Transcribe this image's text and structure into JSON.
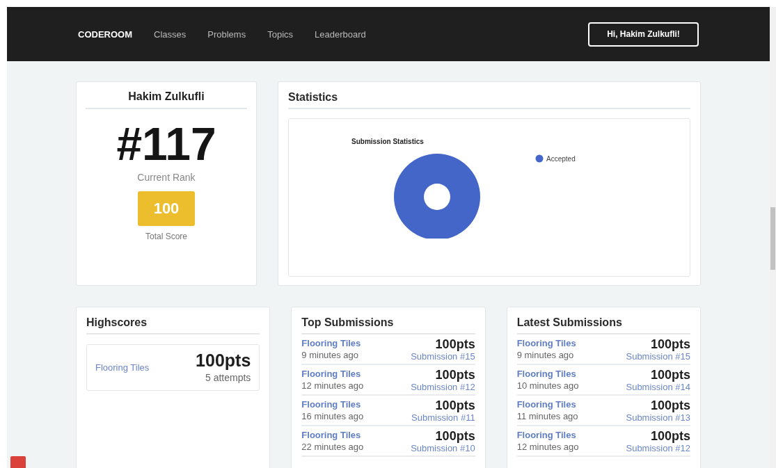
{
  "navbar": {
    "brand": "CODEROOM",
    "links": [
      {
        "label": "Classes"
      },
      {
        "label": "Problems"
      },
      {
        "label": "Topics"
      },
      {
        "label": "Leaderboard"
      }
    ],
    "user_button": "Hi, Hakim Zulkufli!"
  },
  "profile": {
    "name": "Hakim Zulkufli",
    "rank": "#117",
    "rank_label": "Current Rank",
    "score": "100",
    "score_label": "Total Score"
  },
  "statistics": {
    "title": "Statistics",
    "chart_data": {
      "type": "donut",
      "title": "Submission Statistics",
      "categories": [
        "Accepted"
      ]
    }
  },
  "highscores": {
    "title": "Highscores",
    "items": [
      {
        "problem": "Flooring Tiles",
        "points": "100pts",
        "attempts": "5 attempts"
      }
    ]
  },
  "top_submissions": {
    "title": "Top Submissions",
    "items": [
      {
        "problem": "Flooring Tiles",
        "time": "9 minutes ago",
        "points": "100pts",
        "submission": "Submission #15"
      },
      {
        "problem": "Flooring Tiles",
        "time": "12 minutes ago",
        "points": "100pts",
        "submission": "Submission #12"
      },
      {
        "problem": "Flooring Tiles",
        "time": "16 minutes ago",
        "points": "100pts",
        "submission": "Submission #11"
      },
      {
        "problem": "Flooring Tiles",
        "time": "22 minutes ago",
        "points": "100pts",
        "submission": "Submission #10"
      }
    ]
  },
  "latest_submissions": {
    "title": "Latest Submissions",
    "items": [
      {
        "problem": "Flooring Tiles",
        "time": "9 minutes ago",
        "points": "100pts",
        "submission": "Submission #15"
      },
      {
        "problem": "Flooring Tiles",
        "time": "10 minutes ago",
        "points": "100pts",
        "submission": "Submission #14"
      },
      {
        "problem": "Flooring Tiles",
        "time": "11 minutes ago",
        "points": "100pts",
        "submission": "Submission #13"
      },
      {
        "problem": "Flooring Tiles",
        "time": "12 minutes ago",
        "points": "100pts",
        "submission": "Submission #12"
      }
    ]
  }
}
